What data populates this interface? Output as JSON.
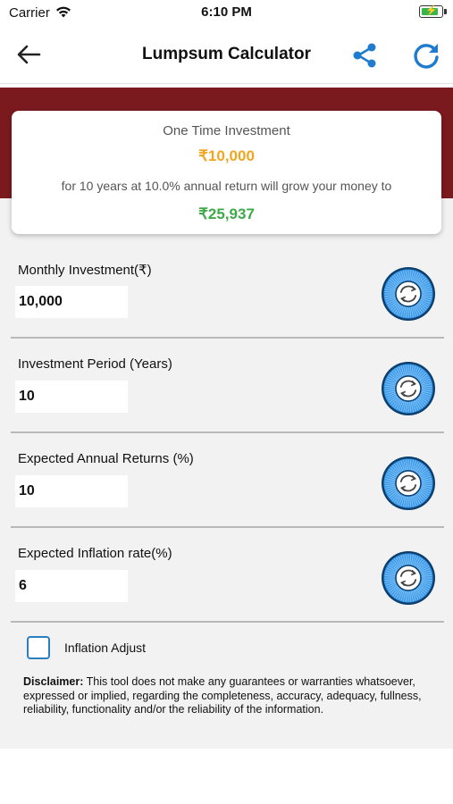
{
  "status_bar": {
    "carrier": "Carrier",
    "time": "6:10 PM"
  },
  "nav": {
    "title": "Lumpsum Calculator",
    "icons": [
      "back-arrow-icon",
      "share-icon",
      "refresh-icon"
    ],
    "accent_color": "#1e7bd0"
  },
  "summary": {
    "heading": "One Time Investment",
    "investment_amount": "₹10,000",
    "description": "for 10 years at 10.0% annual return will grow your money to",
    "result_amount": "₹25,937",
    "investment_color": "#f2a51f",
    "result_color": "#3daa4a"
  },
  "fields": [
    {
      "label": "Monthly Investment(₹)",
      "value": "10,000"
    },
    {
      "label": "Investment Period (Years)",
      "value": "10"
    },
    {
      "label": "Expected Annual Returns (%)",
      "value": "10"
    },
    {
      "label": "Expected Inflation rate(%)",
      "value": "6"
    }
  ],
  "inflation_adjust": {
    "label": "Inflation Adjust",
    "checked": false
  },
  "disclaimer": {
    "title": "Disclaimer:",
    "text": " This tool does not make any guarantees or warranties whatsoever, expressed or implied, regarding the completeness, accuracy, adequacy, fullness, reliability, functionality and/or the reliability of the information."
  },
  "colors": {
    "header_band": "#7a1a1f",
    "background": "#f2f2f3",
    "dial_blue": "#3b98e8"
  }
}
